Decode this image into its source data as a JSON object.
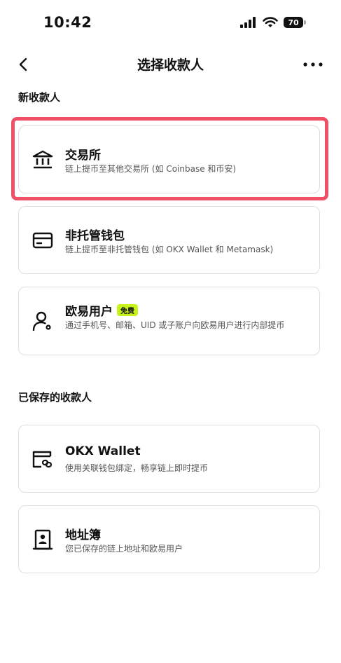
{
  "status_bar": {
    "time": "10:42",
    "battery": "70"
  },
  "nav": {
    "title": "选择收款人"
  },
  "sections": {
    "new_recipient": "新收款人",
    "saved_recipient": "已保存的收款人"
  },
  "options": {
    "exchange": {
      "title": "交易所",
      "desc": "链上提币至其他交易所 (如 Coinbase 和币安)"
    },
    "non_custodial": {
      "title": "非托管钱包",
      "desc": "链上提币至非托管钱包 (如 OKX Wallet 和 Metamask)"
    },
    "okx_user": {
      "title": "欧易用户",
      "badge": "免费",
      "desc": "通过手机号、邮箱、UID 或子账户向欧易用户进行内部提币"
    },
    "okx_wallet": {
      "title": "OKX Wallet",
      "desc": "使用关联钱包绑定，畅享链上即时提币"
    },
    "address_book": {
      "title": "地址簿",
      "desc": "您已保存的链上地址和欧易用户"
    }
  },
  "colors": {
    "highlight": "#f05066",
    "badge": "#c6f31b"
  }
}
